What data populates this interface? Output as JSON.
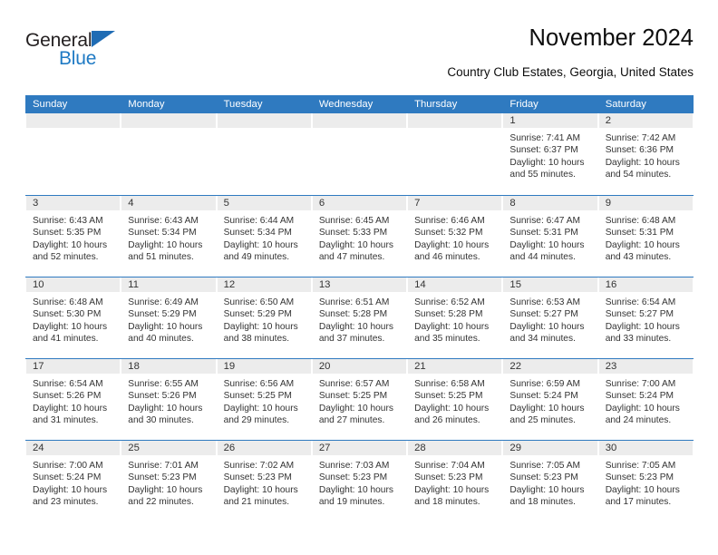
{
  "brand": {
    "name_part1": "General",
    "name_part2": "Blue",
    "triangle_color": "#1f6cb4",
    "blue_color": "#1f7ac4"
  },
  "header": {
    "title": "November 2024",
    "subtitle": "Country Club Estates, Georgia, United States"
  },
  "theme": {
    "header_blue": "#2f7ac0",
    "date_band_gray": "#ececec",
    "text_color": "#333333"
  },
  "calendar": {
    "day_names": [
      "Sunday",
      "Monday",
      "Tuesday",
      "Wednesday",
      "Thursday",
      "Friday",
      "Saturday"
    ],
    "weeks": [
      [
        {
          "empty": true
        },
        {
          "empty": true
        },
        {
          "empty": true
        },
        {
          "empty": true
        },
        {
          "empty": true
        },
        {
          "day": "1",
          "sunrise": "Sunrise: 7:41 AM",
          "sunset": "Sunset: 6:37 PM",
          "daylight1": "Daylight: 10 hours",
          "daylight2": "and 55 minutes."
        },
        {
          "day": "2",
          "sunrise": "Sunrise: 7:42 AM",
          "sunset": "Sunset: 6:36 PM",
          "daylight1": "Daylight: 10 hours",
          "daylight2": "and 54 minutes."
        }
      ],
      [
        {
          "day": "3",
          "sunrise": "Sunrise: 6:43 AM",
          "sunset": "Sunset: 5:35 PM",
          "daylight1": "Daylight: 10 hours",
          "daylight2": "and 52 minutes."
        },
        {
          "day": "4",
          "sunrise": "Sunrise: 6:43 AM",
          "sunset": "Sunset: 5:34 PM",
          "daylight1": "Daylight: 10 hours",
          "daylight2": "and 51 minutes."
        },
        {
          "day": "5",
          "sunrise": "Sunrise: 6:44 AM",
          "sunset": "Sunset: 5:34 PM",
          "daylight1": "Daylight: 10 hours",
          "daylight2": "and 49 minutes."
        },
        {
          "day": "6",
          "sunrise": "Sunrise: 6:45 AM",
          "sunset": "Sunset: 5:33 PM",
          "daylight1": "Daylight: 10 hours",
          "daylight2": "and 47 minutes."
        },
        {
          "day": "7",
          "sunrise": "Sunrise: 6:46 AM",
          "sunset": "Sunset: 5:32 PM",
          "daylight1": "Daylight: 10 hours",
          "daylight2": "and 46 minutes."
        },
        {
          "day": "8",
          "sunrise": "Sunrise: 6:47 AM",
          "sunset": "Sunset: 5:31 PM",
          "daylight1": "Daylight: 10 hours",
          "daylight2": "and 44 minutes."
        },
        {
          "day": "9",
          "sunrise": "Sunrise: 6:48 AM",
          "sunset": "Sunset: 5:31 PM",
          "daylight1": "Daylight: 10 hours",
          "daylight2": "and 43 minutes."
        }
      ],
      [
        {
          "day": "10",
          "sunrise": "Sunrise: 6:48 AM",
          "sunset": "Sunset: 5:30 PM",
          "daylight1": "Daylight: 10 hours",
          "daylight2": "and 41 minutes."
        },
        {
          "day": "11",
          "sunrise": "Sunrise: 6:49 AM",
          "sunset": "Sunset: 5:29 PM",
          "daylight1": "Daylight: 10 hours",
          "daylight2": "and 40 minutes."
        },
        {
          "day": "12",
          "sunrise": "Sunrise: 6:50 AM",
          "sunset": "Sunset: 5:29 PM",
          "daylight1": "Daylight: 10 hours",
          "daylight2": "and 38 minutes."
        },
        {
          "day": "13",
          "sunrise": "Sunrise: 6:51 AM",
          "sunset": "Sunset: 5:28 PM",
          "daylight1": "Daylight: 10 hours",
          "daylight2": "and 37 minutes."
        },
        {
          "day": "14",
          "sunrise": "Sunrise: 6:52 AM",
          "sunset": "Sunset: 5:28 PM",
          "daylight1": "Daylight: 10 hours",
          "daylight2": "and 35 minutes."
        },
        {
          "day": "15",
          "sunrise": "Sunrise: 6:53 AM",
          "sunset": "Sunset: 5:27 PM",
          "daylight1": "Daylight: 10 hours",
          "daylight2": "and 34 minutes."
        },
        {
          "day": "16",
          "sunrise": "Sunrise: 6:54 AM",
          "sunset": "Sunset: 5:27 PM",
          "daylight1": "Daylight: 10 hours",
          "daylight2": "and 33 minutes."
        }
      ],
      [
        {
          "day": "17",
          "sunrise": "Sunrise: 6:54 AM",
          "sunset": "Sunset: 5:26 PM",
          "daylight1": "Daylight: 10 hours",
          "daylight2": "and 31 minutes."
        },
        {
          "day": "18",
          "sunrise": "Sunrise: 6:55 AM",
          "sunset": "Sunset: 5:26 PM",
          "daylight1": "Daylight: 10 hours",
          "daylight2": "and 30 minutes."
        },
        {
          "day": "19",
          "sunrise": "Sunrise: 6:56 AM",
          "sunset": "Sunset: 5:25 PM",
          "daylight1": "Daylight: 10 hours",
          "daylight2": "and 29 minutes."
        },
        {
          "day": "20",
          "sunrise": "Sunrise: 6:57 AM",
          "sunset": "Sunset: 5:25 PM",
          "daylight1": "Daylight: 10 hours",
          "daylight2": "and 27 minutes."
        },
        {
          "day": "21",
          "sunrise": "Sunrise: 6:58 AM",
          "sunset": "Sunset: 5:25 PM",
          "daylight1": "Daylight: 10 hours",
          "daylight2": "and 26 minutes."
        },
        {
          "day": "22",
          "sunrise": "Sunrise: 6:59 AM",
          "sunset": "Sunset: 5:24 PM",
          "daylight1": "Daylight: 10 hours",
          "daylight2": "and 25 minutes."
        },
        {
          "day": "23",
          "sunrise": "Sunrise: 7:00 AM",
          "sunset": "Sunset: 5:24 PM",
          "daylight1": "Daylight: 10 hours",
          "daylight2": "and 24 minutes."
        }
      ],
      [
        {
          "day": "24",
          "sunrise": "Sunrise: 7:00 AM",
          "sunset": "Sunset: 5:24 PM",
          "daylight1": "Daylight: 10 hours",
          "daylight2": "and 23 minutes."
        },
        {
          "day": "25",
          "sunrise": "Sunrise: 7:01 AM",
          "sunset": "Sunset: 5:23 PM",
          "daylight1": "Daylight: 10 hours",
          "daylight2": "and 22 minutes."
        },
        {
          "day": "26",
          "sunrise": "Sunrise: 7:02 AM",
          "sunset": "Sunset: 5:23 PM",
          "daylight1": "Daylight: 10 hours",
          "daylight2": "and 21 minutes."
        },
        {
          "day": "27",
          "sunrise": "Sunrise: 7:03 AM",
          "sunset": "Sunset: 5:23 PM",
          "daylight1": "Daylight: 10 hours",
          "daylight2": "and 19 minutes."
        },
        {
          "day": "28",
          "sunrise": "Sunrise: 7:04 AM",
          "sunset": "Sunset: 5:23 PM",
          "daylight1": "Daylight: 10 hours",
          "daylight2": "and 18 minutes."
        },
        {
          "day": "29",
          "sunrise": "Sunrise: 7:05 AM",
          "sunset": "Sunset: 5:23 PM",
          "daylight1": "Daylight: 10 hours",
          "daylight2": "and 18 minutes."
        },
        {
          "day": "30",
          "sunrise": "Sunrise: 7:05 AM",
          "sunset": "Sunset: 5:23 PM",
          "daylight1": "Daylight: 10 hours",
          "daylight2": "and 17 minutes."
        }
      ]
    ]
  }
}
